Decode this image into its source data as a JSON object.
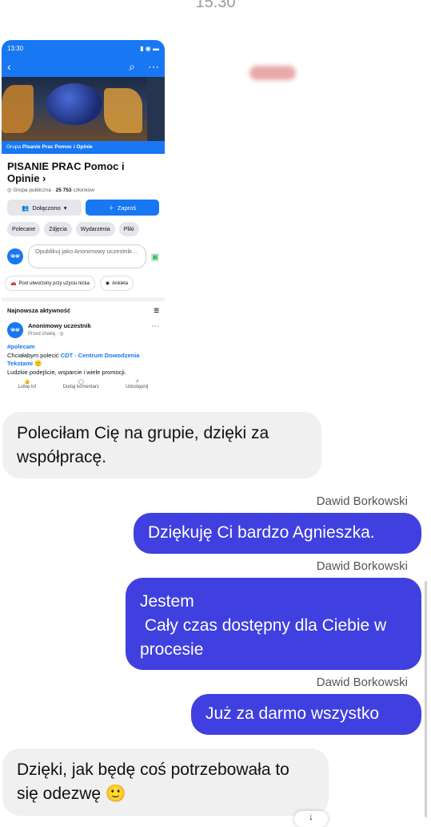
{
  "top_time": "15:30",
  "shot": {
    "status_time": "13:30",
    "group_label_prefix": "Grupa",
    "group_label_name": "Pisanie Prac Pomoc i Opinie",
    "title": "PISANIE PRAC Pomoc i Opinie ›",
    "meta_type": "Grupa publiczna ·",
    "meta_count": "25 753",
    "meta_suffix": "członków",
    "joined_label": "Dołączono",
    "invite_label": "Zaproś",
    "chips": [
      "Polecane",
      "Zdjęcia",
      "Wydarzenia",
      "Pliki"
    ],
    "compose_placeholder": "Opublikuj jako Anonimowy uczestnik…",
    "tags": [
      "Post utworzony przy użyciu nicka",
      "Ankieta"
    ],
    "activity_label": "Najnowsza aktywność",
    "post": {
      "author": "Anonimowy uczestnik",
      "time": "Przed chwilą · ",
      "hashtag": "#polecam",
      "text_before": "Chciałabym polecić ",
      "link": "CDT - Centrum Dowodzenia Tekstami",
      "emoji": " 🙂",
      "text_after": "Ludzkie podejście, wsparcie i wiele promocji."
    },
    "actions": [
      "Lubię to!",
      "Dodaj komentarz",
      "Udostępnij"
    ]
  },
  "messages": [
    {
      "dir": "in",
      "text": "Poleciłam Cię na grupie, dzięki za współpracę."
    },
    {
      "dir": "out",
      "sender": "Dawid Borkowski",
      "text": "Dziękuję Ci bardzo Agnieszka."
    },
    {
      "dir": "out",
      "sender": "Dawid Borkowski",
      "text": "Jestem\n Cały czas dostępny dla Ciebie w procesie"
    },
    {
      "dir": "out",
      "sender": "Dawid Borkowski",
      "text": "Już za darmo wszystko"
    },
    {
      "dir": "in",
      "text": "Dzięki, jak będę coś potrzebowała to się odezwę 🙂"
    }
  ],
  "colors": {
    "outgoing": "#4040e0",
    "incoming": "#f0f0f0",
    "fb_blue": "#1877f2"
  }
}
